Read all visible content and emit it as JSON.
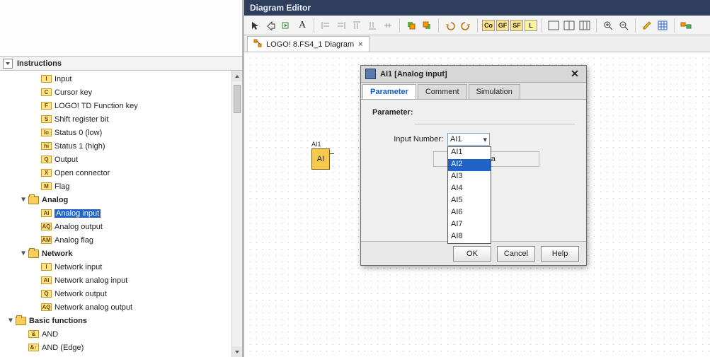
{
  "left": {
    "header": "Instructions",
    "items": [
      {
        "ind": 2,
        "badge": "I",
        "label": "Input"
      },
      {
        "ind": 2,
        "badge": "C",
        "label": "Cursor key"
      },
      {
        "ind": 2,
        "badge": "F",
        "label": "LOGO! TD Function key"
      },
      {
        "ind": 2,
        "badge": "S",
        "label": "Shift register bit"
      },
      {
        "ind": 2,
        "badge": "lo",
        "label": "Status 0 (low)"
      },
      {
        "ind": 2,
        "badge": "hi",
        "label": "Status 1 (high)"
      },
      {
        "ind": 2,
        "badge": "Q",
        "label": "Output"
      },
      {
        "ind": 2,
        "badge": "X",
        "label": "Open connector"
      },
      {
        "ind": 2,
        "badge": "M",
        "label": "Flag"
      },
      {
        "ind": 1,
        "folder": true,
        "toggle": "▾",
        "label": "Analog",
        "bold": true
      },
      {
        "ind": 2,
        "badge": "AI",
        "label": "Analog input",
        "selected": true
      },
      {
        "ind": 2,
        "badge": "AQ",
        "label": "Analog output"
      },
      {
        "ind": 2,
        "badge": "AM",
        "label": "Analog flag"
      },
      {
        "ind": 1,
        "folder": true,
        "toggle": "▾",
        "label": "Network",
        "bold": true
      },
      {
        "ind": 2,
        "badge": "I",
        "label": "Network input"
      },
      {
        "ind": 2,
        "badge": "AI",
        "label": "Network analog input"
      },
      {
        "ind": 2,
        "badge": "Q",
        "label": "Network output"
      },
      {
        "ind": 2,
        "badge": "AQ",
        "label": "Network analog output"
      },
      {
        "ind": 0,
        "folder": true,
        "toggle": "▾",
        "label": "Basic functions",
        "bold": true
      },
      {
        "ind": 1,
        "badge": "&",
        "label": "AND"
      },
      {
        "ind": 1,
        "badge": "&↑",
        "label": "AND (Edge)"
      }
    ]
  },
  "editor": {
    "title": "Diagram Editor",
    "tab": "LOGO! 8.FS4_1 Diagram",
    "toolbar_marks": {
      "co": "Co",
      "gf": "GF",
      "sf": "SF",
      "l": "L"
    }
  },
  "block": {
    "name": "AI1",
    "short": "AI"
  },
  "dialog": {
    "title": "AI1 [Analog input]",
    "tabs": [
      "Parameter",
      "Comment",
      "Simulation"
    ],
    "section": "Parameter:",
    "field_label": "Input Number:",
    "value": "AI1",
    "a3_button": "AI3 a",
    "options": [
      "AI1",
      "AI2",
      "AI3",
      "AI4",
      "AI5",
      "AI6",
      "AI7",
      "AI8"
    ],
    "selected_option": "AI2",
    "buttons": {
      "ok": "OK",
      "cancel": "Cancel",
      "help": "Help"
    }
  }
}
